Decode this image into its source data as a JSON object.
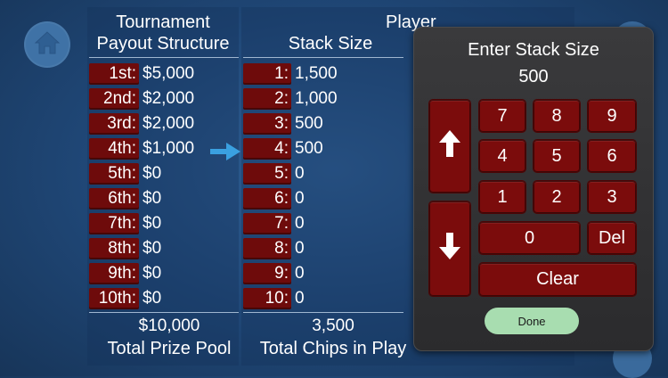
{
  "left_column": {
    "header_line1": "Tournament",
    "header_line2": "Payout Structure",
    "rows": [
      {
        "place": "1st:",
        "amount": "$5,000"
      },
      {
        "place": "2nd:",
        "amount": "$2,000"
      },
      {
        "place": "3rd:",
        "amount": "$2,000"
      },
      {
        "place": "4th:",
        "amount": "$1,000"
      },
      {
        "place": "5th:",
        "amount": "$0"
      },
      {
        "place": "6th:",
        "amount": "$0"
      },
      {
        "place": "7th:",
        "amount": "$0"
      },
      {
        "place": "8th:",
        "amount": "$0"
      },
      {
        "place": "9th:",
        "amount": "$0"
      },
      {
        "place": "10th:",
        "amount": "$0"
      }
    ],
    "total_value": "$10,000",
    "total_label": "Total Prize Pool"
  },
  "right_column": {
    "header_line1": "Player",
    "header_line2": "Stack Size",
    "rows": [
      {
        "player": "1:",
        "stack": "1,500"
      },
      {
        "player": "2:",
        "stack": "1,000"
      },
      {
        "player": "3:",
        "stack": "500"
      },
      {
        "player": "4:",
        "stack": "500"
      },
      {
        "player": "5:",
        "stack": "0"
      },
      {
        "player": "6:",
        "stack": "0"
      },
      {
        "player": "7:",
        "stack": "0"
      },
      {
        "player": "8:",
        "stack": "0"
      },
      {
        "player": "9:",
        "stack": "0"
      },
      {
        "player": "10:",
        "stack": "0"
      }
    ],
    "total_value": "3,500",
    "total_label": "Total Chips in Play"
  },
  "keypad": {
    "title": "Enter Stack Size",
    "value": "500",
    "keys": {
      "k7": "7",
      "k8": "8",
      "k9": "9",
      "k4": "4",
      "k5": "5",
      "k6": "6",
      "k1": "1",
      "k2": "2",
      "k3": "3",
      "k0": "0",
      "del": "Del",
      "clear": "Clear"
    },
    "done_label": "Done"
  },
  "colors": {
    "background": "#1f4675",
    "badge": "#6e0b0b",
    "key": "#7b0c0c",
    "done": "#a8ddb0",
    "arrow": "#3aa0e0"
  },
  "icons": {
    "home": "home-icon",
    "up": "arrow-up-icon",
    "down": "arrow-down-icon",
    "current_player": "arrow-right-icon"
  }
}
